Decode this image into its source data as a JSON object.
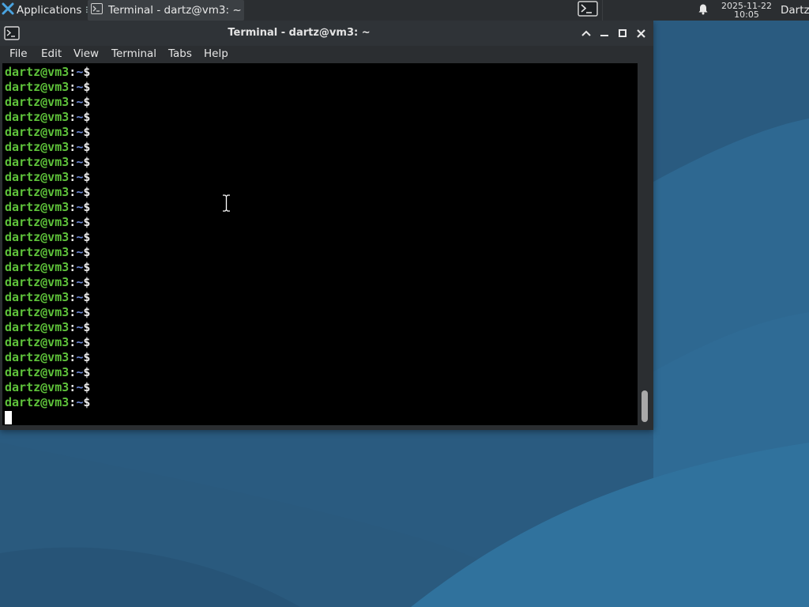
{
  "panel": {
    "apps_label": "Applications",
    "task_title": "Terminal - dartz@vm3: ~",
    "clock_date": "2025-11-22",
    "clock_time": "10:05",
    "user": "Dartz"
  },
  "window": {
    "title": "Terminal - dartz@vm3: ~",
    "menu": [
      "File",
      "Edit",
      "View",
      "Terminal",
      "Tabs",
      "Help"
    ]
  },
  "terminal": {
    "prompt_user": "dartz@vm3",
    "prompt_colon": ":",
    "prompt_path": "~",
    "prompt_symbol": "$",
    "prompt_count": 23
  },
  "colors": {
    "prompt_user": "#5ec23a",
    "prompt_path": "#6e8ad6",
    "terminal_bg": "#000000",
    "panel_bg": "#2b2e31",
    "desktop": "#2b5f84"
  },
  "icons": {
    "app_menu": "xfce-mouse-icon",
    "task": "terminal-icon",
    "launcher": "terminal-icon",
    "notify": "bell-icon",
    "window_controls": [
      "chevron-up-icon",
      "minimize-icon",
      "maximize-icon",
      "close-icon"
    ]
  }
}
